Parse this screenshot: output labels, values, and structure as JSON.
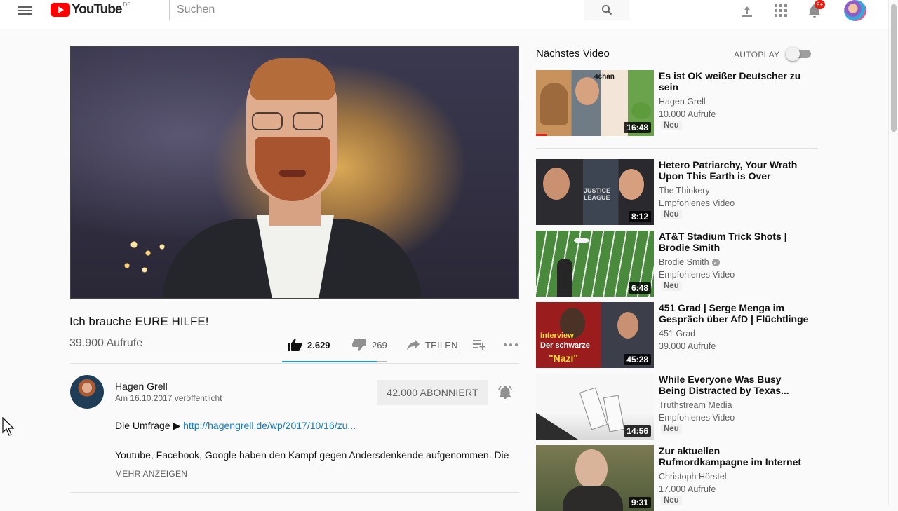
{
  "header": {
    "logo_text": "YouTube",
    "country": "DE",
    "search_placeholder": "Suchen",
    "notification_count": "9+"
  },
  "video": {
    "title": "Ich brauche EURE HILFE!",
    "views": "39.900 Aufrufe",
    "likes": "2.629",
    "dislikes": "269",
    "share_label": "TEILEN",
    "like_ratio": 0.907
  },
  "owner": {
    "name": "Hagen Grell",
    "published": "Am 16.10.2017 veröffentlicht",
    "subscribe_label": "42.000 ABONNIERT"
  },
  "description": {
    "line1_prefix": "Die Umfrage ▶ ",
    "line1_link": "http://hagengrell.de/wp/2017/10/16/zu...",
    "line2": "Youtube, Facebook, Google haben den Kampf gegen Andersdenkende aufgenommen. Die",
    "show_more": "MEHR ANZEIGEN"
  },
  "sidebar": {
    "up_next": "Nächstes Video",
    "autoplay": "AUTOPLAY",
    "autoplay_on": false,
    "items": [
      {
        "title": "Es ist OK weißer Deutscher zu sein",
        "channel": "Hagen Grell",
        "meta": "10.000 Aufrufe",
        "badge": "Neu",
        "duration": "16:48",
        "verified": false,
        "watched": 0.1
      },
      {
        "title": "Hetero Patriarchy, Your Wrath Upon This Earth is Over",
        "channel": "The Thinkery",
        "meta": "Empfohlenes Video",
        "badge": "Neu",
        "duration": "8:12",
        "verified": false,
        "watched": 0
      },
      {
        "title": "AT&T Stadium Trick Shots | Brodie Smith",
        "channel": "Brodie Smith",
        "meta": "Empfohlenes Video",
        "badge": "Neu",
        "duration": "6:48",
        "verified": true,
        "watched": 0
      },
      {
        "title": "451 Grad | Serge Menga im Gespräch über AfD | Flüchtlinge",
        "channel": "451 Grad",
        "meta": "39.000 Aufrufe",
        "badge": "",
        "duration": "45:28",
        "verified": false,
        "watched": 0
      },
      {
        "title": "While Everyone Was Busy Being Distracted by Texas...",
        "channel": "Truthstream Media",
        "meta": "Empfohlenes Video",
        "badge": "Neu",
        "duration": "14:56",
        "verified": false,
        "watched": 0
      },
      {
        "title": "Zur aktuellen Rufmordkampagne im Internet",
        "channel": "Christoph Hörstel",
        "meta": "17.000 Aufrufe",
        "badge": "Neu",
        "duration": "9:31",
        "verified": false,
        "watched": 0
      }
    ],
    "thumb_texts": {
      "t1_label": "4chan",
      "t2_label": "JUSTICE LEAGUE",
      "t4_label1": "Interview",
      "t4_label2": "Der schwarze",
      "t4_label3": "\"Nazi\""
    }
  },
  "colors": {
    "accent_red": "#ff0000",
    "link_blue": "#167ac6",
    "like_bar_blue": "#2793e6"
  },
  "icons": [
    "menu-icon",
    "search-icon",
    "upload-icon",
    "apps-icon",
    "bell-icon",
    "thumb-up-icon",
    "thumb-down-icon",
    "share-icon",
    "add-to-playlist-icon",
    "more-icon",
    "notification-bell-icon",
    "verified-icon"
  ]
}
